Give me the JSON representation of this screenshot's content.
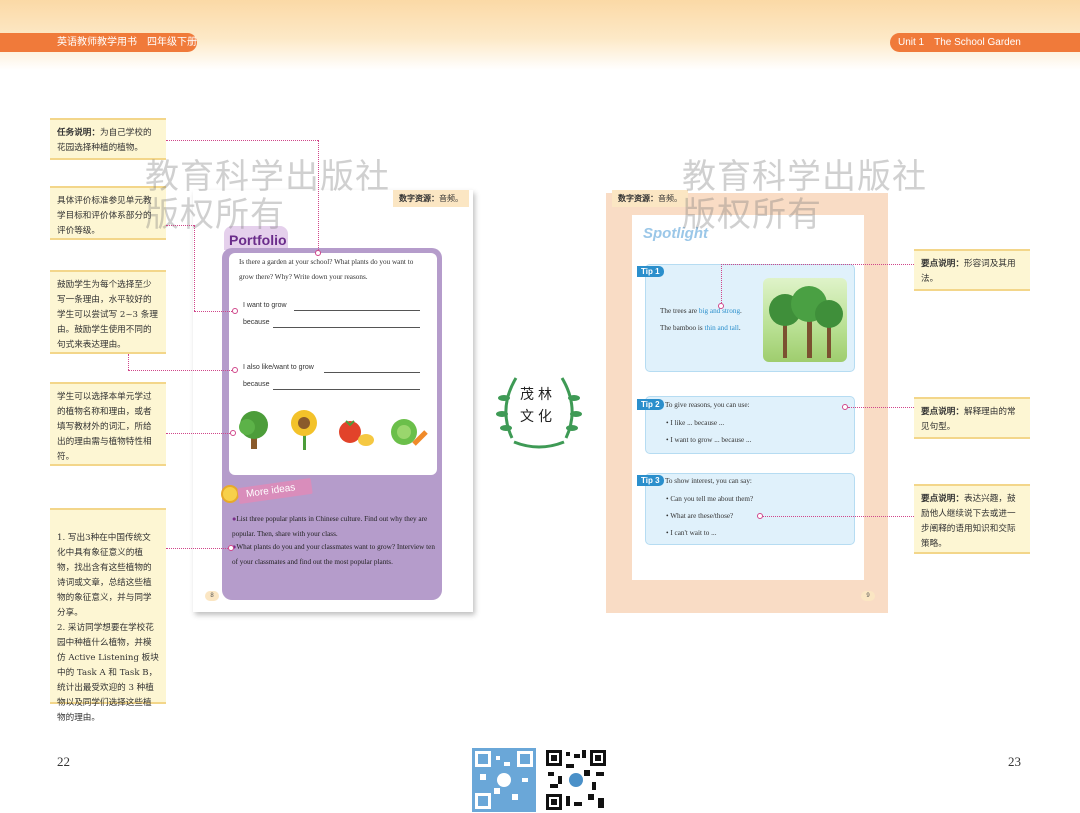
{
  "header": {
    "left_title": "英语教师教学用书　四年级下册",
    "right_title": "Unit 1　The School Garden"
  },
  "watermark": {
    "line1": "教育科学出版社",
    "line2": "版权所有"
  },
  "left_notes": [
    {
      "label": "任务说明：",
      "text": "为自己学校的花园选择种植的植物。"
    },
    {
      "label": "",
      "text": "具体评价标准参见单元教学目标和评价体系部分的评价等级。"
    },
    {
      "label": "",
      "text": "鼓励学生为每个选择至少写一条理由，水平较好的学生可以尝试写 2~3 条理由。鼓励学生使用不同的句式来表达理由。"
    },
    {
      "label": "",
      "text": "学生可以选择本单元学过的植物名称和理由，或者填写教材外的词汇，所给出的理由需与植物特性相符。"
    },
    {
      "label": "",
      "text": "1. 写出3种在中国传统文化中具有象征意义的植物，找出含有这些植物的诗词或文章，总结这些植物的象征意义，并与同学分享。\n2. 采访同学想要在学校花园中种植什么植物，并模仿 Active Listening 板块中的 Task A 和 Task B，统计出最受欢迎的 3 种植物以及同学们选择这些植物的理由。"
    }
  ],
  "right_notes": [
    {
      "label": "要点说明：",
      "text": "形容词及其用法。"
    },
    {
      "label": "要点说明：",
      "text": "解释理由的常见句型。"
    },
    {
      "label": "要点说明：",
      "text": "表达兴趣，鼓励他人继续说下去或进一步阐释的语用知识和交际策略。"
    }
  ],
  "left_page": {
    "resource_label": "数字资源：",
    "resource_text": "音频。",
    "section_title": "Portfolio",
    "question": "Is there a garden at your school? What plants do you want to grow there? Why? Write down your reasons.",
    "line1_prompt": "I want to grow",
    "line1_because": "because",
    "line2_prompt": "I also like/want to grow",
    "line2_because": "because",
    "more_ideas_title": "More ideas",
    "idea1": "List three popular plants in Chinese culture. Find out why they are popular. Then, share with your class.",
    "idea2": "What plants do you and your classmates want to grow? Interview ten of your classmates and find out the most popular plants.",
    "page_number": "8",
    "pictures": [
      "tree-icon",
      "sunflower-icon",
      "tomato-icon",
      "vegetables-icon"
    ]
  },
  "right_page": {
    "resource_label": "数字资源：",
    "resource_text": "音频。",
    "section_title": "Spotlight",
    "tip1": {
      "tag": "Tip 1",
      "line1_pre": "The trees are ",
      "line1_hl": "big and strong",
      "line1_post": ".",
      "line2_pre": "The bamboo is ",
      "line2_hl": "thin and tall",
      "line2_post": "."
    },
    "tip2": {
      "tag": "Tip 2",
      "heading": "To give reasons, you can use:",
      "items": [
        "I like ... because ...",
        "I want to grow ... because ..."
      ]
    },
    "tip3": {
      "tag": "Tip 3",
      "heading": "To show interest, you can say:",
      "items": [
        "Can you tell me about them?",
        "What are these/those?",
        "I can't wait to ..."
      ]
    },
    "page_number": "9"
  },
  "logo": {
    "text": "茂林文化"
  },
  "folios": {
    "left": "22",
    "right": "23"
  },
  "colors": {
    "accent": "#f07a3a",
    "connector": "#d0468a",
    "tip_blue": "#2b8fcc",
    "portfolio_purple": "#b59ccb"
  }
}
